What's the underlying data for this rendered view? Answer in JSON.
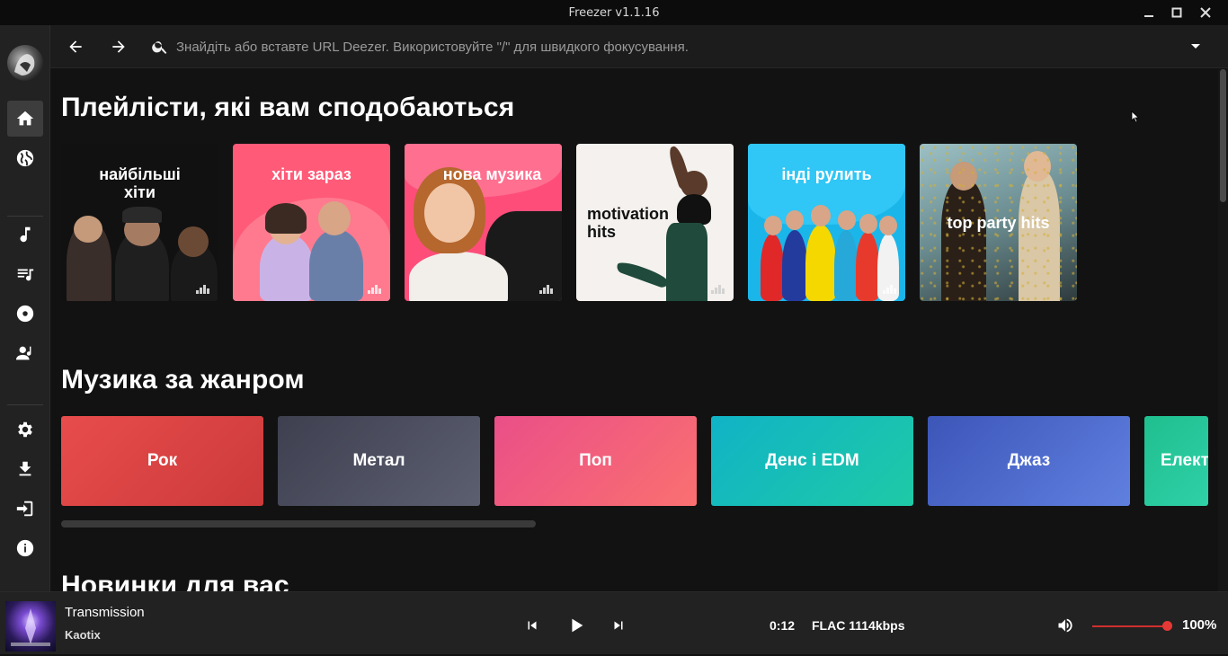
{
  "window": {
    "title": "Freezer v1.1.16"
  },
  "search": {
    "placeholder": "Знайдіть або вставте URL Deezer. Використовуйте \"/\" для швидкого фокусування."
  },
  "sections": {
    "playlists_title": "Плейлісти, які вам сподобаються",
    "genres_title": "Музика за жанром",
    "new_title": "Новинки для вас"
  },
  "playlists": [
    {
      "label_line1": "найбільші",
      "label_line2": "хіти",
      "bg": "#111111"
    },
    {
      "label_line1": "хіти зараз",
      "label_line2": "",
      "bg": "#ff5a78"
    },
    {
      "label_line1": "нова музика",
      "label_line2": "",
      "bg": "#ff4d7a"
    },
    {
      "label_line1": "motivation",
      "label_line2": "hits",
      "bg": "#f4f1ee"
    },
    {
      "label_line1": "інді рулить",
      "label_line2": "",
      "bg": "#1ab6ea"
    },
    {
      "label_line1": "top party hits",
      "label_line2": "",
      "bg": "#7fa4a8"
    }
  ],
  "genres": [
    {
      "label": "Рок",
      "color": "#e04848"
    },
    {
      "label": "Метал",
      "color": "#4f5160"
    },
    {
      "label": "Поп",
      "color": "#f0587a"
    },
    {
      "label": "Денс і EDM",
      "color": "#13c0b8"
    },
    {
      "label": "Джаз",
      "color": "#4c6bd8"
    },
    {
      "label": "Електро",
      "color": "#2cc79a"
    }
  ],
  "player": {
    "title": "Transmission",
    "artist": "Kaotix",
    "time": "0:12",
    "quality": "FLAC 1114kbps",
    "volume": "100%",
    "volume_level": 1.0
  },
  "icons": {
    "nav": [
      "home-icon",
      "globe-icon",
      "music-note-icon",
      "playlist-icon",
      "album-icon",
      "artist-icon",
      "settings-icon",
      "download-icon",
      "login-icon",
      "info-icon"
    ]
  }
}
